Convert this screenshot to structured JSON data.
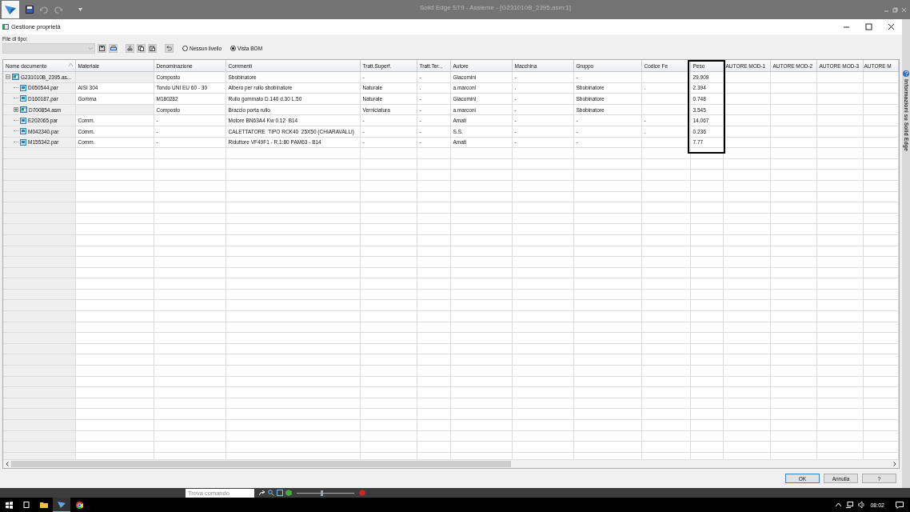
{
  "app": {
    "title": "Solid Edge ST9 - Assieme - [G231010B_2395.asm:1]"
  },
  "dialog": {
    "title": "Gestione proprietà",
    "file_type_label": "File di tipo:",
    "view_options": [
      {
        "label": "Nessun livello",
        "selected": false
      },
      {
        "label": "Vista BOM",
        "selected": true
      }
    ],
    "table": {
      "columns": [
        {
          "label": "Nome documento"
        },
        {
          "label": "Materiale"
        },
        {
          "label": "Denominazione"
        },
        {
          "label": "Commenti"
        },
        {
          "label": "Tratt.Superf."
        },
        {
          "label": "Tratt.Ter..."
        },
        {
          "label": "Autore"
        },
        {
          "label": "Macchina"
        },
        {
          "label": "Gruppo"
        },
        {
          "label": "Codice Fe"
        },
        {
          "label": "Peso"
        },
        {
          "label": "AUTORE MOD-1"
        },
        {
          "label": "AUTORE MOD-2"
        },
        {
          "label": "AUTORE MOD-3"
        },
        {
          "label": "AUTORE M"
        }
      ],
      "rows": [
        {
          "name": "G231010B_2395.as...",
          "kind": "assembly",
          "expanded": true,
          "cells": {
            "denominazione": "Composto",
            "commenti": "Sbobinatore",
            "tratt_superf": "-",
            "tratt_ter": "-",
            "autore": "Giacomini",
            "macchina": "-",
            "gruppo": "-",
            "peso": "29.909"
          },
          "children": [
            {
              "name": "D050544.par",
              "kind": "part",
              "cells": {
                "materiale": "AISI 304",
                "denominazione": "Tondo UNI EU 60 - 30",
                "commenti": "Albero per rullo sbobinatore",
                "tratt_superf": "Naturale",
                "tratt_ter": ".",
                "autore": "a.marconi",
                "macchina": ".",
                "gruppo": "Sbobinatore",
                "codice_fe": ".",
                "peso": "2.394"
              }
            },
            {
              "name": "D160187.par",
              "kind": "part",
              "cells": {
                "materiale": "Gomma",
                "denominazione": "M180282",
                "commenti": "Rullo gommato D.140 d.30 L.50",
                "tratt_superf": "Naturale",
                "tratt_ter": "-",
                "autore": "Giacomini",
                "macchina": "-",
                "gruppo": "Sbobinatore",
                "peso": "0.748"
              }
            },
            {
              "name": "D700854.asm",
              "kind": "assembly",
              "expanded": false,
              "cells": {
                "denominazione": "Composto",
                "commenti": "Braccio porta rullo",
                "tratt_superf": "Verniciatura",
                "tratt_ter": "-",
                "autore": "a.marconi",
                "macchina": "-",
                "gruppo": "Sbobinatore",
                "peso": "3.545"
              }
            },
            {
              "name": "E202065.par",
              "kind": "part",
              "cells": {
                "materiale": "Comm.",
                "denominazione": "-",
                "commenti": "Motore BN63A4 Kw 0.12  B14",
                "tratt_superf": "-",
                "tratt_ter": "-",
                "autore": "Amati",
                "macchina": "-",
                "gruppo": "-",
                "codice_fe": "-",
                "peso": "14.067"
              }
            },
            {
              "name": "M042340.par",
              "kind": "part",
              "cells": {
                "materiale": "Comm.",
                "denominazione": "-",
                "commenti": "CALETTATORE  TIPO RCK40  25X50 (CHIARAVALLI)",
                "tratt_superf": "-",
                "tratt_ter": "-",
                "autore": "S.S.",
                "macchina": "-",
                "gruppo": "-",
                "codice_fe": ".",
                "peso": "0.236"
              }
            },
            {
              "name": "M155342.par",
              "kind": "part",
              "cells": {
                "materiale": "Comm.",
                "denominazione": "-",
                "commenti": "Riduttore VF49F1 - R.1:80 PAM63 - B14",
                "tratt_superf": "-",
                "tratt_ter": "-",
                "autore": "Amati",
                "macchina": "-",
                "gruppo": "-",
                "peso": "7.77"
              }
            }
          ]
        }
      ]
    },
    "buttons": [
      {
        "label": "OK",
        "default": true
      },
      {
        "label": "Annulla",
        "default": false
      },
      {
        "label": "?",
        "default": false
      }
    ]
  },
  "side_panel": {
    "title": "Informazioni su Solid Edge"
  },
  "status_bar": {
    "search": {
      "placeholder": "Trova comando"
    },
    "zoom_slider": {
      "level": 0.42
    }
  },
  "taskbar": {
    "clock": "08:02"
  }
}
